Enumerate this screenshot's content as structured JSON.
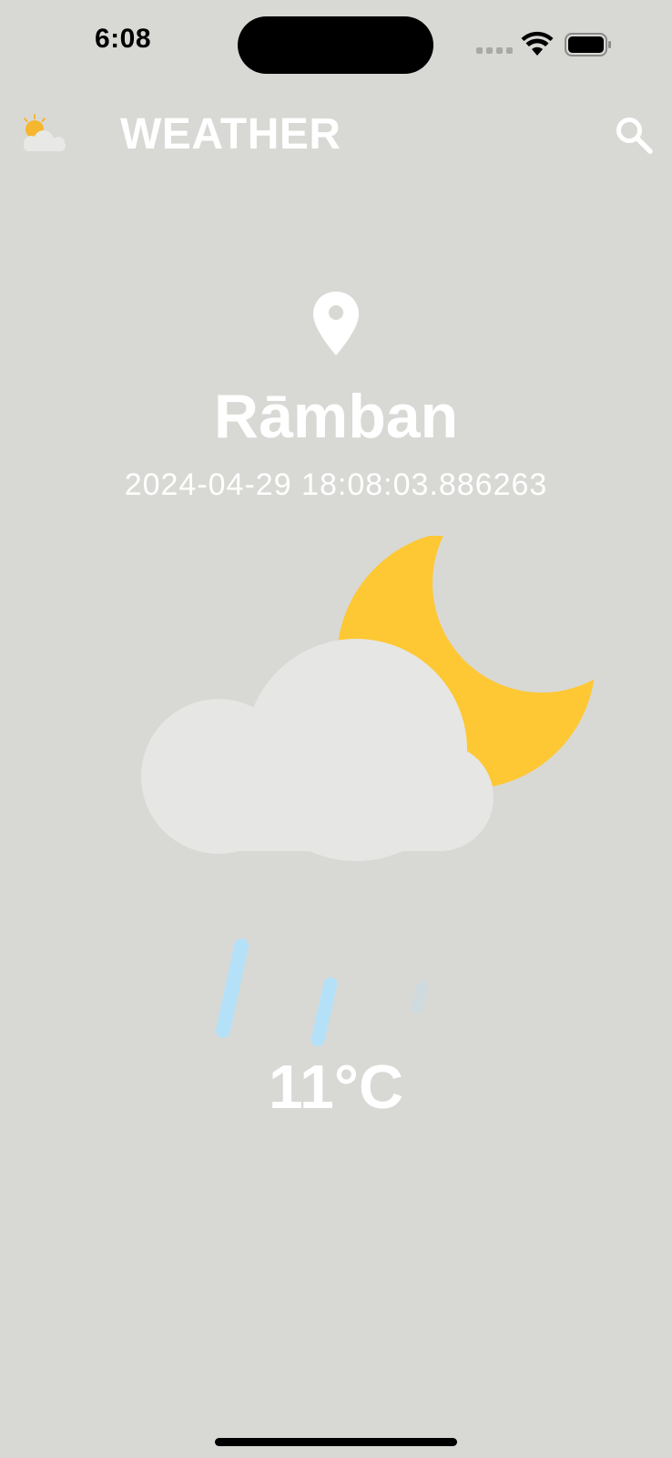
{
  "status_bar": {
    "time": "6:08"
  },
  "app_bar": {
    "title": "WEATHER",
    "logo_icon": "partly-cloudy-icon",
    "search_icon": "search-icon"
  },
  "location": {
    "icon": "location-pin-icon",
    "city": "Rāmban",
    "timestamp": "2024-04-29 18:08:03.886263"
  },
  "weather": {
    "condition_icon": "moon-cloud-rain-icon",
    "temperature": "11°C"
  },
  "colors": {
    "background": "#d8d9d5",
    "text": "#ffffff",
    "moon": "#fdc834",
    "cloud": "#e6e6e5",
    "rain": "#b5e1f8"
  }
}
